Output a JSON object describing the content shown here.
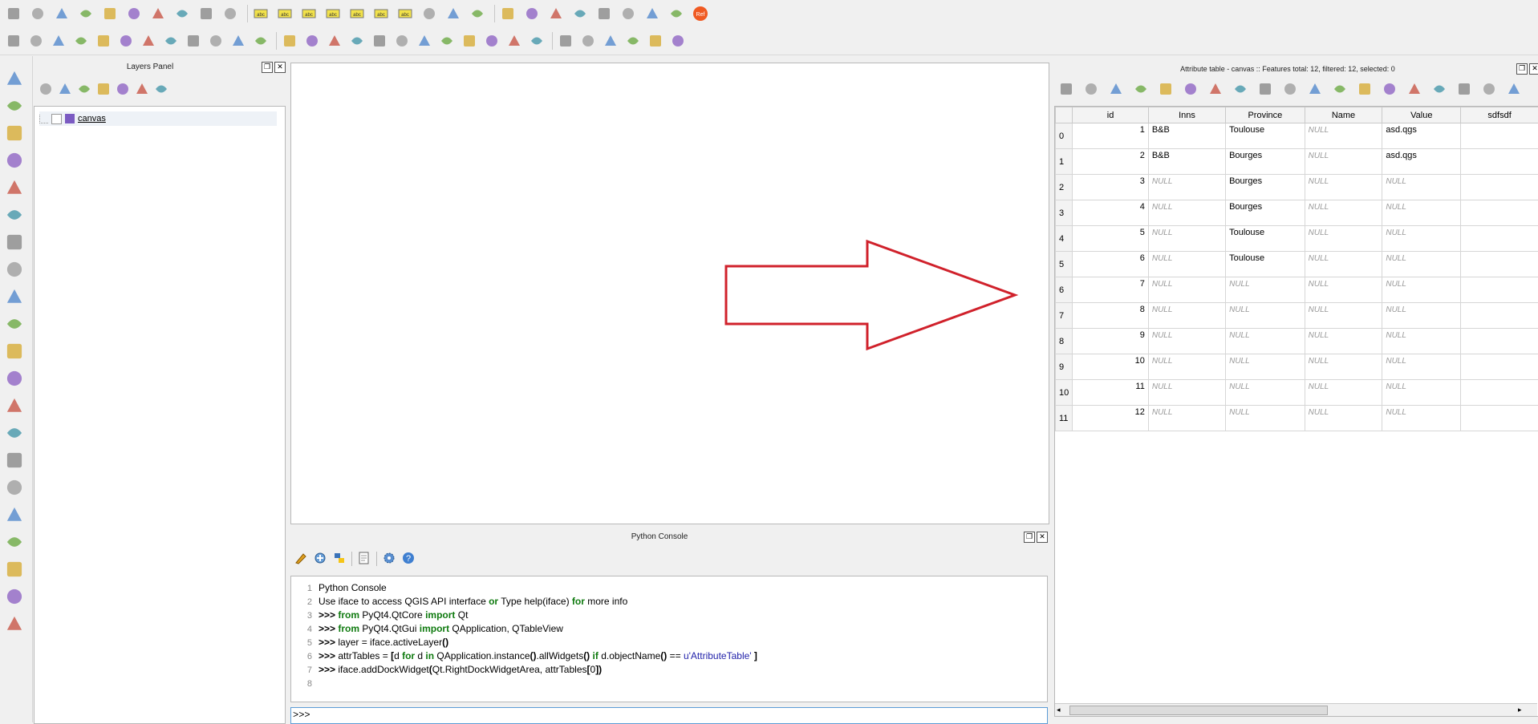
{
  "layers_panel": {
    "title": "Layers Panel",
    "layers": [
      {
        "name": "canvas",
        "color": "#7b5bc2",
        "checked": false
      }
    ]
  },
  "python_console": {
    "title": "Python Console",
    "lines": [
      {
        "n": "1",
        "parts": [
          {
            "t": "Python Console",
            "k": "plain"
          }
        ]
      },
      {
        "n": "2",
        "parts": [
          {
            "t": "Use iface to access QGIS API interface ",
            "k": "plain"
          },
          {
            "t": "or",
            "k": "kw"
          },
          {
            "t": " Type help(iface) ",
            "k": "plain"
          },
          {
            "t": "for",
            "k": "kw"
          },
          {
            "t": " more info",
            "k": "plain"
          }
        ]
      },
      {
        "n": "3",
        "parts": [
          {
            "t": ">>> ",
            "k": "bold"
          },
          {
            "t": "from",
            "k": "kw"
          },
          {
            "t": " PyQt4.QtCore ",
            "k": "plain"
          },
          {
            "t": "import",
            "k": "kw"
          },
          {
            "t": " Qt",
            "k": "plain"
          }
        ]
      },
      {
        "n": "4",
        "parts": [
          {
            "t": ">>> ",
            "k": "bold"
          },
          {
            "t": "from",
            "k": "kw"
          },
          {
            "t": " PyQt4.QtGui ",
            "k": "plain"
          },
          {
            "t": "import",
            "k": "kw"
          },
          {
            "t": " QApplication, QTableView",
            "k": "plain"
          }
        ]
      },
      {
        "n": "5",
        "parts": [
          {
            "t": ">>> ",
            "k": "bold"
          },
          {
            "t": "layer = iface.activeLayer",
            "k": "plain"
          },
          {
            "t": "()",
            "k": "bold"
          }
        ]
      },
      {
        "n": "6",
        "parts": [
          {
            "t": ">>> ",
            "k": "bold"
          },
          {
            "t": "attrTables = ",
            "k": "plain"
          },
          {
            "t": "[",
            "k": "bold"
          },
          {
            "t": "d ",
            "k": "plain"
          },
          {
            "t": "for",
            "k": "kw"
          },
          {
            "t": " d ",
            "k": "plain"
          },
          {
            "t": "in",
            "k": "kw"
          },
          {
            "t": " QApplication.instance",
            "k": "plain"
          },
          {
            "t": "()",
            "k": "bold"
          },
          {
            "t": ".allWidgets",
            "k": "plain"
          },
          {
            "t": "()",
            "k": "bold"
          },
          {
            "t": " ",
            "k": "plain"
          },
          {
            "t": "if",
            "k": "kw"
          },
          {
            "t": " d.objectName",
            "k": "plain"
          },
          {
            "t": "()",
            "k": "bold"
          },
          {
            "t": " == ",
            "k": "plain"
          },
          {
            "t": "u'AttributeTable'",
            "k": "str"
          },
          {
            "t": " ",
            "k": "plain"
          },
          {
            "t": "]",
            "k": "bold"
          }
        ]
      },
      {
        "n": "7",
        "parts": [
          {
            "t": ">>> ",
            "k": "bold"
          },
          {
            "t": "iface.addDockWidget",
            "k": "plain"
          },
          {
            "t": "(",
            "k": "bold"
          },
          {
            "t": "Qt.RightDockWidgetArea, attrTables",
            "k": "plain"
          },
          {
            "t": "[",
            "k": "bold"
          },
          {
            "t": "0",
            "k": "plain"
          },
          {
            "t": "])",
            "k": "bold"
          }
        ]
      },
      {
        "n": "8",
        "parts": []
      }
    ],
    "prompt": ">>>"
  },
  "attribute_table": {
    "title": "Attribute table - canvas :: Features total: 12, filtered: 12, selected: 0",
    "columns": [
      "id",
      "Inns",
      "Province",
      "Name",
      "Value",
      "sdfsdf"
    ],
    "rows": [
      {
        "h": "0",
        "id": "1",
        "Inns": "B&B",
        "Province": "Toulouse",
        "Name": "NULL",
        "Value": "asd.qgs",
        "sdfsdf": ""
      },
      {
        "h": "1",
        "id": "2",
        "Inns": "B&B",
        "Province": "Bourges",
        "Name": "NULL",
        "Value": "asd.qgs",
        "sdfsdf": ""
      },
      {
        "h": "2",
        "id": "3",
        "Inns": "NULL",
        "Province": "Bourges",
        "Name": "NULL",
        "Value": "NULL",
        "sdfsdf": ""
      },
      {
        "h": "3",
        "id": "4",
        "Inns": "NULL",
        "Province": "Bourges",
        "Name": "NULL",
        "Value": "NULL",
        "sdfsdf": ""
      },
      {
        "h": "4",
        "id": "5",
        "Inns": "NULL",
        "Province": "Toulouse",
        "Name": "NULL",
        "Value": "NULL",
        "sdfsdf": ""
      },
      {
        "h": "5",
        "id": "6",
        "Inns": "NULL",
        "Province": "Toulouse",
        "Name": "NULL",
        "Value": "NULL",
        "sdfsdf": ""
      },
      {
        "h": "6",
        "id": "7",
        "Inns": "NULL",
        "Province": "NULL",
        "Name": "NULL",
        "Value": "NULL",
        "sdfsdf": ""
      },
      {
        "h": "7",
        "id": "8",
        "Inns": "NULL",
        "Province": "NULL",
        "Name": "NULL",
        "Value": "NULL",
        "sdfsdf": ""
      },
      {
        "h": "8",
        "id": "9",
        "Inns": "NULL",
        "Province": "NULL",
        "Name": "NULL",
        "Value": "NULL",
        "sdfsdf": ""
      },
      {
        "h": "9",
        "id": "10",
        "Inns": "NULL",
        "Province": "NULL",
        "Name": "NULL",
        "Value": "NULL",
        "sdfsdf": ""
      },
      {
        "h": "10",
        "id": "11",
        "Inns": "NULL",
        "Province": "NULL",
        "Name": "NULL",
        "Value": "NULL",
        "sdfsdf": ""
      },
      {
        "h": "11",
        "id": "12",
        "Inns": "NULL",
        "Province": "NULL",
        "Name": "NULL",
        "Value": "NULL",
        "sdfsdf": ""
      }
    ]
  },
  "toolbar_icons": {
    "row1": [
      "edit-pencil-icon",
      "toggle-editing-icon",
      "save-edits-icon",
      "add-feature-icon",
      "node-tool-icon",
      "move-feature-icon",
      "delete-selected-icon",
      "cut-icon",
      "copy-icon",
      "paste-icon",
      "label-icon",
      "label-pin-icon",
      "label-show-icon",
      "label-move-icon",
      "label-rotate-icon",
      "label-change-icon",
      "label-settings-icon",
      "plugin-green-icon",
      "plugin-hd-icon",
      "plugin-film-icon",
      "plugin-layers-icon",
      "plugin-box-icon",
      "plugin-db-icon",
      "globe-wms-icon",
      "python-icon",
      "metasearch-icon",
      "refresh-arrow-icon",
      "cloud-icon",
      "ref-badge-icon"
    ],
    "row2": [
      "digitize-icon",
      "rotate-icon",
      "undo-icon",
      "redo-icon",
      "simplify-icon",
      "ring-icon",
      "add-part-icon",
      "fill-ring-icon",
      "delete-ring-icon",
      "delete-part-icon",
      "reshape-icon",
      "offset-curve-icon",
      "split-features-icon",
      "split-parts-icon",
      "merge-features-icon",
      "merge-attributes-icon",
      "rotate-point-icon",
      "node-add-icon",
      "node-del-icon",
      "trace-icon",
      "snap-icon",
      "snap2-icon",
      "snap3-icon",
      "snap4-icon",
      "snap5-icon",
      "grid-icon",
      "pin-icon",
      "raster-icon",
      "sigma-icon",
      "grid-select-icon"
    ],
    "left": [
      "add-vector-icon",
      "add-raster-icon",
      "add-postgis-icon",
      "add-spatialite-icon",
      "add-mssql-icon",
      "add-oracle-icon",
      "add-db2-icon",
      "add-wms-icon",
      "add-wcs-icon",
      "add-wfs-icon",
      "add-delimited-icon",
      "add-virtual-icon",
      "new-layer-icon",
      "gps-icon",
      "capture-icon",
      "digitize-point-icon",
      "trace-line-icon",
      "georef-icon",
      "edit-vector-icon",
      "statistics-icon",
      "notes-icon"
    ]
  },
  "ref_badge": "Ref"
}
